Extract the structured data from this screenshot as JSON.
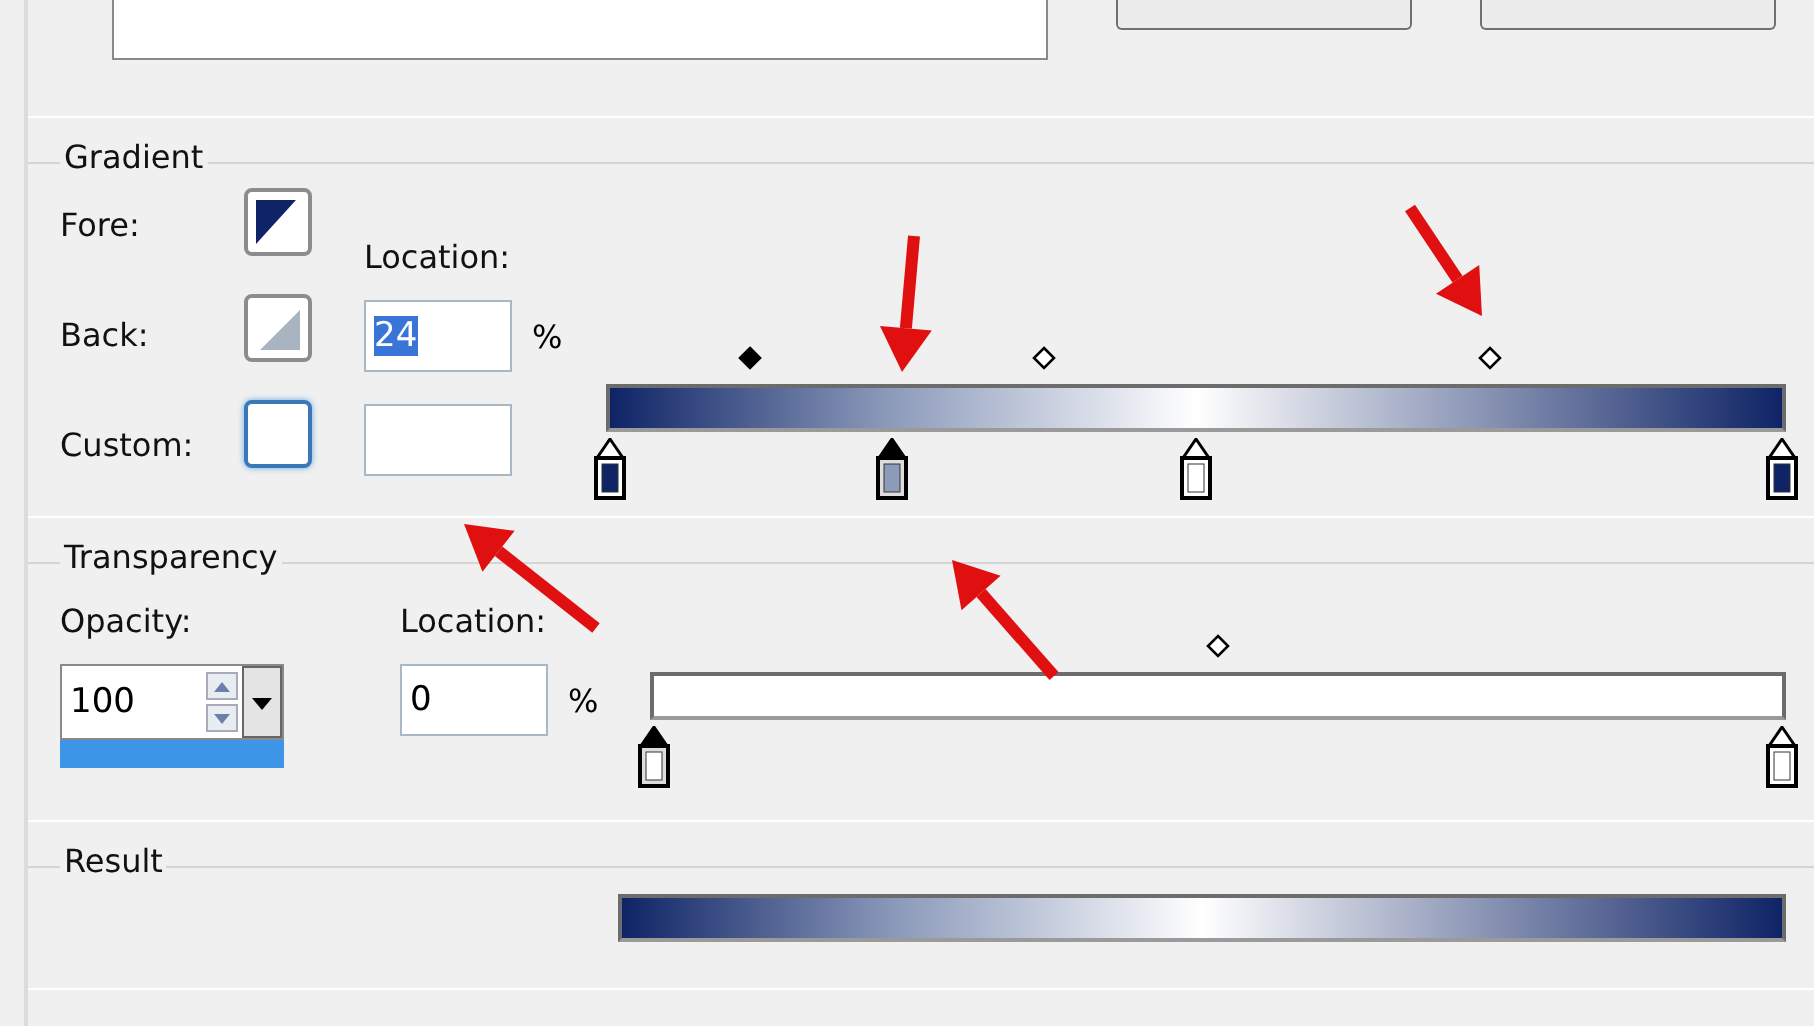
{
  "gradient": {
    "title": "Gradient",
    "swatches": [
      {
        "label": "Fore:",
        "kind": "triangle",
        "color": "#0f2466",
        "selected": false
      },
      {
        "label": "Back:",
        "kind": "triangle",
        "color": "#a8b4bf",
        "selected": false
      },
      {
        "label": "Custom:",
        "kind": "plain",
        "color": "#ffffff",
        "selected": true
      }
    ],
    "location": {
      "label": "Location:",
      "value": "24",
      "unit": "%"
    },
    "midpoints": [
      {
        "level": 0.12,
        "selected": true
      },
      {
        "level": 0.37,
        "selected": false
      },
      {
        "level": 0.75,
        "selected": false
      }
    ],
    "stops": [
      {
        "level": 0,
        "color": "#0f2466",
        "selected": false
      },
      {
        "level": 0.24,
        "color": "#8d9bbb",
        "selected": true
      },
      {
        "level": 0.5,
        "color": "#ffffff",
        "selected": false
      },
      {
        "level": 1,
        "color": "#0f2466",
        "selected": false
      }
    ]
  },
  "transparency": {
    "title": "Transparency",
    "opacity": {
      "label": "Opacity:",
      "value": "100"
    },
    "location": {
      "label": "Location:",
      "value": "0",
      "unit": "%"
    },
    "midpoints": [
      {
        "level": 0.5,
        "selected": false
      }
    ],
    "stops": [
      {
        "level": 0,
        "color": "#ffffff",
        "selected": true
      },
      {
        "level": 1,
        "color": "#ffffff",
        "selected": false
      }
    ]
  },
  "result": {
    "title": "Result"
  }
}
